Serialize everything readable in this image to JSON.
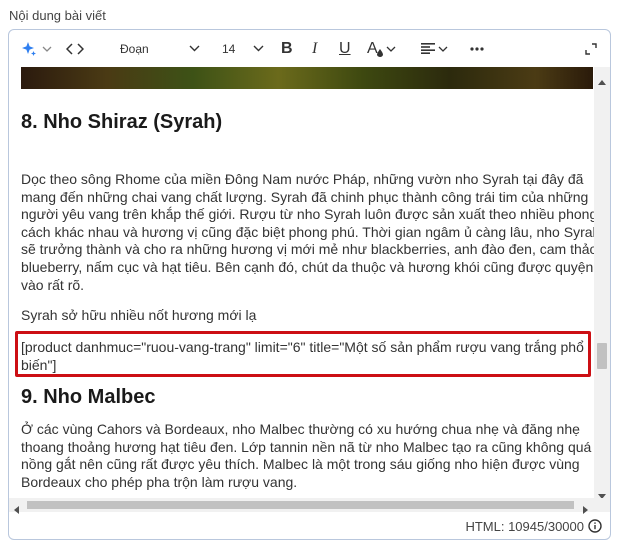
{
  "field": {
    "label": "Nội dung bài viết"
  },
  "toolbar": {
    "ai_icon": "sparkle-icon",
    "code_icon": "code-icon",
    "format_select": "Đoạn",
    "font_size_select": "14",
    "bold_label": "B",
    "italic_label": "I",
    "underline_label": "U",
    "text_color_label": "A",
    "align_icon": "align-left-icon",
    "more_icon": "more-icon",
    "fullscreen_icon": "expand-icon"
  },
  "document": {
    "heading_8": "8. Nho Shiraz (Syrah)",
    "para_1": [
      "Dọc theo sông Rhome của miền Đông Nam nước Pháp, những vườn nho Syrah tại đây đã",
      "mang đến những chai vang chất lượng. Syrah đã chinh phục thành công trái tim của những",
      "người yêu vang trên khắp thế giới. Rượu từ nho Syrah luôn được sản xuất theo nhiều phong",
      "cách khác nhau và hương vị cũng đặc biệt phong phú. Thời gian ngâm ủ càng lâu, nho Syrah",
      "sẽ trưởng thành và cho ra những hương vị mới mẻ như blackberries, anh đào đen, cam thảo,",
      "blueberry, nấm cục và hạt tiêu. Bên cạnh đó, chút da thuộc và hương khói cũng được quyện",
      "vào rất rõ."
    ],
    "para_2": "Syrah sở hữu nhiều nốt hương mới lạ",
    "shortcode": [
      "[product danhmuc=\"ruou-vang-trang\" limit=\"6\" title=\"Một số sản phẩm rượu vang trắng phổ",
      "biến\"]"
    ],
    "heading_9": "9. Nho Malbec",
    "para_3": [
      "Ở các vùng Cahors và Bordeaux, nho Malbec thường có xu hướng chua nhẹ và đăng nhẹ",
      "thoang thoảng hương hạt tiêu đen. Lớp tannin nền nã từ nho Malbec tạo ra cũng không quá",
      "nồng gắt nên cũng rất được yêu thích. Malbec là một trong sáu giống nho hiện được vùng",
      "Bordeaux cho phép pha trộn làm rượu vang."
    ]
  },
  "status": {
    "char_count": "HTML: 10945/30000",
    "info_icon": "info-icon"
  },
  "colors": {
    "highlight_border": "#cc0f14",
    "editor_border": "#b9c7dd",
    "ai_icon": "#2f7ff0"
  }
}
